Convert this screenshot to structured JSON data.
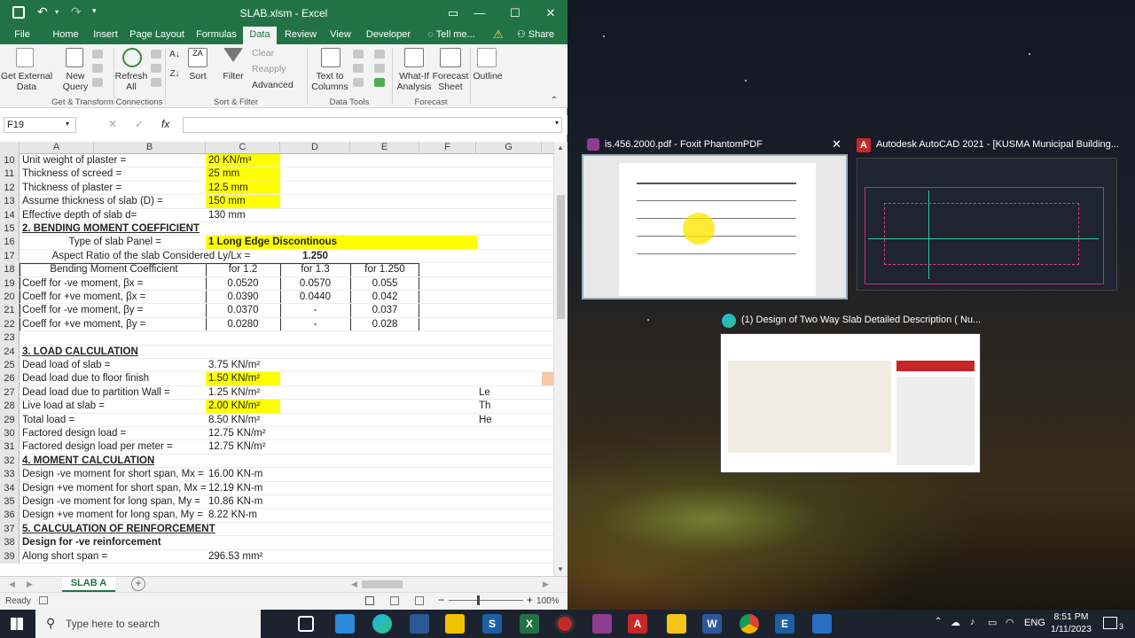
{
  "excel": {
    "title": "SLAB.xlsm  -  Excel",
    "qat_sep": "|",
    "tabs": [
      "File",
      "Home",
      "Insert",
      "Page Layout",
      "Formulas",
      "Data",
      "Review",
      "View",
      "Developer",
      "Tell me...",
      "Share"
    ],
    "ribbon": {
      "get_external": "Get External\nData",
      "new_query": "New\nQuery",
      "refresh_all": "Refresh\nAll",
      "sort": "Sort",
      "filter": "Filter",
      "clear": "Clear",
      "reapply": "Reapply",
      "advanced": "Advanced",
      "text_to_columns": "Text to\nColumns",
      "what_if": "What-If\nAnalysis",
      "forecast_sheet": "Forecast\nSheet",
      "outline": "Outline",
      "groups": [
        "Get & Transform",
        "Connections",
        "Sort & Filter",
        "Data Tools",
        "Forecast"
      ]
    },
    "name_box": "F19",
    "fx": "fx",
    "columns": [
      "A",
      "B",
      "C",
      "D",
      "E",
      "F",
      "G"
    ],
    "rows": [
      {
        "n": "10",
        "a": "Unit weight of plaster =",
        "c": "20 KN/m³"
      },
      {
        "n": "11",
        "a": "Thickness of screed =",
        "c": "25 mm"
      },
      {
        "n": "12",
        "a": "Thickness of plaster =",
        "c": "12.5 mm"
      },
      {
        "n": "13",
        "a": "Assume thickness of slab (D)  =",
        "c": "150 mm"
      },
      {
        "n": "14",
        "a": "Effective depth of slab d=",
        "c": "130 mm"
      },
      {
        "n": "15",
        "a": "2.  BENDING MOMENT COEFFICIENT"
      },
      {
        "n": "16",
        "a": "Type of slab Panel =",
        "c": "1 Long Edge Discontinous"
      },
      {
        "n": "17",
        "a": "Aspect Ratio of the slab Considered Ly/Lx =",
        "d": "1.250"
      },
      {
        "n": "18",
        "a": "Bending Moment Coefficient",
        "c": "for 1.2",
        "d": "for 1.3",
        "e": "for 1.250"
      },
      {
        "n": "19",
        "a": "Coeff for -ve moment, βx =",
        "c": "0.0520",
        "d": "0.0570",
        "e": "0.055"
      },
      {
        "n": "20",
        "a": "Coeff for +ve  moment, βx =",
        "c": "0.0390",
        "d": "0.0440",
        "e": "0.042"
      },
      {
        "n": "21",
        "a": "Coeff for -ve  moment, βy =",
        "c": "0.0370",
        "d": "-",
        "e": "0.037"
      },
      {
        "n": "22",
        "a": "Coeff for +ve  moment, βy =",
        "c": "0.0280",
        "d": "-",
        "e": "0.028"
      },
      {
        "n": "23"
      },
      {
        "n": "24",
        "a": "3.  LOAD CALCULATION"
      },
      {
        "n": "25",
        "a": "Dead load of slab =",
        "c": "3.75 KN/m²"
      },
      {
        "n": "26",
        "a": "Dead load due to floor finish",
        "c": "1.50 KN/m²"
      },
      {
        "n": "27",
        "a": "Dead load due to partition Wall =",
        "c": "1.25 KN/m²",
        "g": "Le"
      },
      {
        "n": "28",
        "a": "Live load at slab =",
        "c": "2.00 KN/m²",
        "g": "Th"
      },
      {
        "n": "29",
        "a": "Total load =",
        "c": "8.50 KN/m²",
        "g": "He"
      },
      {
        "n": "30",
        "a": "Factored design load =",
        "c": "12.75 KN/m²"
      },
      {
        "n": "31",
        "a": "Factored design load per meter =",
        "c": "12.75 KN/m²"
      },
      {
        "n": "32",
        "a": "4.  MOMENT CALCULATION"
      },
      {
        "n": "33",
        "a": "Design -ve moment for short span, Mx =",
        "c": "16.00 KN-m"
      },
      {
        "n": "34",
        "a": "Design +ve moment for short span, Mx =",
        "c": "12.19 KN-m"
      },
      {
        "n": "35",
        "a": "Design -ve moment for long span, My =",
        "c": "10.86 KN-m"
      },
      {
        "n": "36",
        "a": "Design +ve moment for long span, My =",
        "c": "8.22 KN-m"
      },
      {
        "n": "37",
        "a": "5.  CALCULATION OF REINFORCEMENT"
      },
      {
        "n": "38",
        "a": "Design for -ve reinforcement"
      },
      {
        "n": "39",
        "a": "Along short span =",
        "c": "296.53 mm²"
      }
    ],
    "sheet_tab": "SLAB A",
    "add_sheet": "+",
    "status": "Ready",
    "zoom": "100%"
  },
  "taskview": {
    "windows": [
      {
        "title": "is.456.2000.pdf - Foxit PhantomPDF",
        "icon": "foxit-icon"
      },
      {
        "title": "Autodesk AutoCAD 2021 - [KUSMA Municipal Building...",
        "icon": "autocad-icon"
      },
      {
        "title": "(1) Design of Two Way Slab Detailed Description ( Nu...",
        "icon": "edge-icon"
      }
    ],
    "close": "✕"
  },
  "taskbar": {
    "search_placeholder": "Type here to search",
    "lang": "ENG",
    "time": "8:51 PM",
    "date": "1/11/2023",
    "notifications": "3"
  }
}
